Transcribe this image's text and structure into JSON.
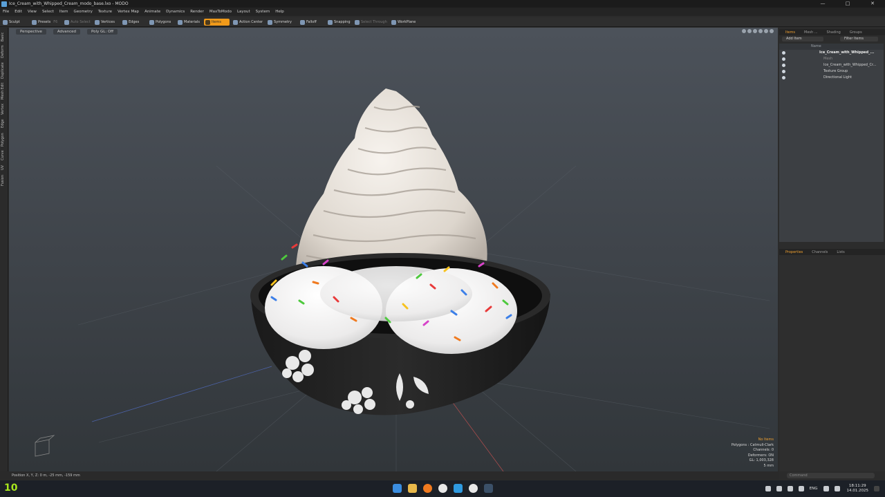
{
  "window": {
    "title": "Ice_Cream_with_Whipped_Cream_modo_base.lxo - MODO",
    "controls": [
      "—",
      "□",
      "✕"
    ]
  },
  "menu": [
    "File",
    "Edit",
    "View",
    "Select",
    "Item",
    "Geometry",
    "Texture",
    "Vertex Map",
    "Animate",
    "Dynamics",
    "Render",
    "MaxToModo",
    "Layout",
    "System",
    "Help"
  ],
  "toolbar": {
    "sculpt": "Sculpt",
    "presets": "Presets",
    "presets_key": "F6",
    "auto_select": "Auto Select",
    "vertices": "Vertices",
    "edges": "Edges",
    "polygons": "Polygons",
    "materials": "Materials",
    "items": "Items",
    "action_center": "Action Center",
    "symmetry": "Symmetry",
    "falloff": "Falloff",
    "snapping": "Snapping",
    "select_through": "Select Through",
    "workplane": "WorkPlane"
  },
  "left_tabs": [
    "Basic",
    "Deform",
    "Duplicate",
    "Mesh Edit",
    "Vertex",
    "Edge",
    "Polygon",
    "Curve",
    "UV",
    "Fusion"
  ],
  "viewport": {
    "view_mode": "Perspective",
    "shading": "Advanced",
    "gl_mode": "Poly GL: Off",
    "stats": {
      "selection": "No Items",
      "polygons": "Polygons : Catmull-Clark",
      "channels": "Channels: 0",
      "deformers": "Deformers: ON",
      "gl": "GL: 1,003,328",
      "distance": "5 mm"
    }
  },
  "status": {
    "position": "Position X, Y, Z:  0 m, -25 mm, -159 mm"
  },
  "items_panel": {
    "tabs": [
      "Items",
      "Mesh ...",
      "Shading",
      "Groups"
    ],
    "add_item": "Add Item",
    "filter_items": "Filter Items",
    "column_name": "Name",
    "tree": [
      {
        "label": "Ice_Cream_with_Whipped_...",
        "level": 0,
        "style": "bold"
      },
      {
        "label": "Mesh",
        "level": 1,
        "style": "dim"
      },
      {
        "label": "Ice_Cream_with_Whipped_Cr...",
        "level": 1,
        "style": "normal"
      },
      {
        "label": "Texture Group",
        "level": 1,
        "style": "normal"
      },
      {
        "label": "Directional Light",
        "level": 1,
        "style": "normal"
      }
    ]
  },
  "properties_panel": {
    "tabs": [
      "Properties",
      "Channels",
      "Lists"
    ]
  },
  "command_placeholder": "Command",
  "taskbar": {
    "widget": "10",
    "lang": "ENG",
    "time": "18:11:29",
    "date": "14.01.2025"
  },
  "colors": {
    "accent": "#f09a1a",
    "viewport_top": "#4c525a",
    "viewport_bottom": "#31363a"
  }
}
